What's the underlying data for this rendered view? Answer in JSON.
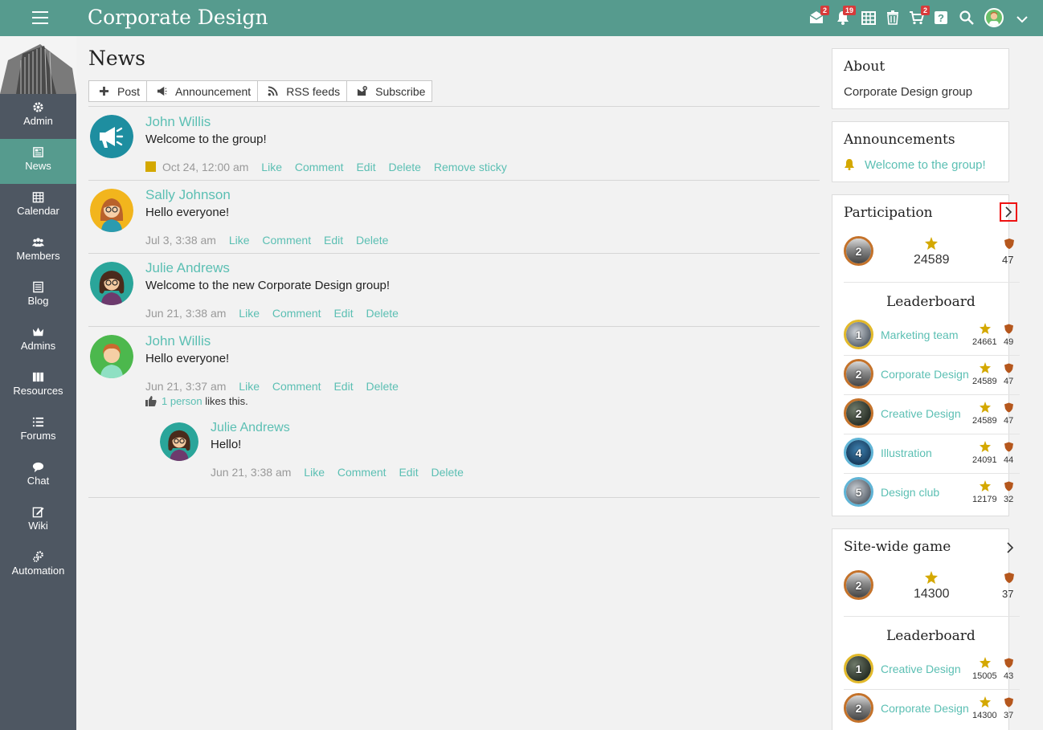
{
  "app": {
    "title": "Corporate Design"
  },
  "topbar": {
    "icons": [
      {
        "name": "messages-icon",
        "badge": "2"
      },
      {
        "name": "notifications-icon",
        "badge": "19"
      },
      {
        "name": "calendar-icon",
        "badge": ""
      },
      {
        "name": "trash-icon",
        "badge": ""
      },
      {
        "name": "cart-icon",
        "badge": "2"
      },
      {
        "name": "help-icon",
        "badge": ""
      },
      {
        "name": "search-icon",
        "badge": ""
      }
    ]
  },
  "sidebar": {
    "items": [
      {
        "label": "Admin",
        "icon": "gear-icon"
      },
      {
        "label": "News",
        "icon": "news-icon"
      },
      {
        "label": "Calendar",
        "icon": "calendar-icon"
      },
      {
        "label": "Members",
        "icon": "members-icon"
      },
      {
        "label": "Blog",
        "icon": "blog-icon"
      },
      {
        "label": "Admins",
        "icon": "crown-icon"
      },
      {
        "label": "Resources",
        "icon": "resources-icon"
      },
      {
        "label": "Forums",
        "icon": "forums-icon"
      },
      {
        "label": "Chat",
        "icon": "chat-icon"
      },
      {
        "label": "Wiki",
        "icon": "wiki-icon"
      },
      {
        "label": "Automation",
        "icon": "automation-icon"
      }
    ],
    "active": "News"
  },
  "main": {
    "title": "News",
    "actions": [
      {
        "label": "Post",
        "icon": "plus-icon"
      },
      {
        "label": "Announcement",
        "icon": "megaphone-icon"
      },
      {
        "label": "RSS feeds",
        "icon": "rss-icon"
      },
      {
        "label": "Subscribe",
        "icon": "subscribe-icon"
      }
    ],
    "posts": [
      {
        "author": "John Willis",
        "text": "Welcome to the group!",
        "time": "Oct 24, 12:00 am",
        "links": [
          "Like",
          "Comment",
          "Edit",
          "Delete",
          "Remove sticky"
        ]
      },
      {
        "author": "Sally Johnson",
        "text": "Hello everyone!",
        "time": "Jul 3, 3:38 am",
        "links": [
          "Like",
          "Comment",
          "Edit",
          "Delete"
        ]
      },
      {
        "author": "Julie Andrews",
        "text": "Welcome to the new Corporate Design group!",
        "time": "Jun 21, 3:38 am",
        "links": [
          "Like",
          "Comment",
          "Edit",
          "Delete"
        ]
      },
      {
        "author": "John Willis",
        "text": "Hello everyone!",
        "time": "Jun 21, 3:37 am",
        "links": [
          "Like",
          "Comment",
          "Edit",
          "Delete"
        ],
        "likes_link": "1 person",
        "likes_suffix": "likes this."
      }
    ],
    "comment": {
      "author": "Julie Andrews",
      "text": "Hello!",
      "time": "Jun 21, 3:38 am",
      "links": [
        "Like",
        "Comment",
        "Edit",
        "Delete"
      ]
    }
  },
  "about": {
    "title": "About",
    "text": "Corporate Design group"
  },
  "announcements": {
    "title": "Announcements",
    "item": "Welcome to the group!"
  },
  "participation": {
    "title": "Participation",
    "rank": "2",
    "points": "24589",
    "badges": "47",
    "leaderboard_title": "Leaderboard",
    "leaderboard": [
      {
        "rank": "1",
        "name": "Marketing team",
        "points": "24661",
        "badges": "49"
      },
      {
        "rank": "2",
        "name": "Corporate Design",
        "points": "24589",
        "badges": "47"
      },
      {
        "rank": "2",
        "name": "Creative Design",
        "points": "24589",
        "badges": "47"
      },
      {
        "rank": "4",
        "name": "Illustration",
        "points": "24091",
        "badges": "44"
      },
      {
        "rank": "5",
        "name": "Design club",
        "points": "12179",
        "badges": "32"
      }
    ]
  },
  "sitewide": {
    "title": "Site-wide game",
    "rank": "2",
    "points": "14300",
    "badges": "37",
    "leaderboard_title": "Leaderboard",
    "leaderboard": [
      {
        "rank": "1",
        "name": "Creative Design",
        "points": "15005",
        "badges": "43"
      },
      {
        "rank": "2",
        "name": "Corporate Design",
        "points": "14300",
        "badges": "37"
      }
    ]
  },
  "colors": {
    "accent": "#569b8e",
    "link": "#5bbfb3",
    "sidebar": "#4e5762",
    "star": "#d4a800",
    "shield": "#b5571d",
    "badge": "#d73a3a"
  }
}
